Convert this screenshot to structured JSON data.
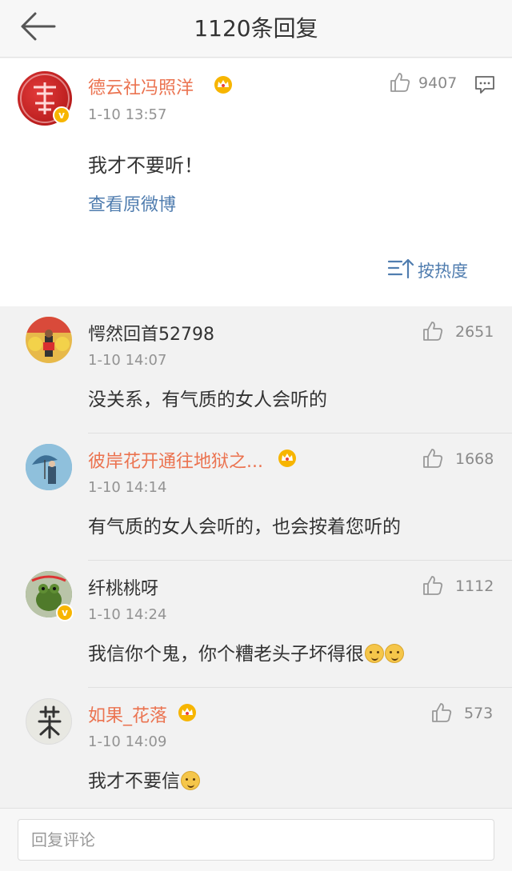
{
  "header": {
    "title": "1120条回复",
    "back_icon": "arrow-left-icon"
  },
  "main_post": {
    "author": "德云社冯照洋",
    "time": "1-10 13:57",
    "likes": "9407",
    "content": "我才不要听！",
    "view_original": "查看原微博",
    "sort_label": "按热度"
  },
  "comments": [
    {
      "author": "愕然回首52798",
      "time": "1-10 14:07",
      "likes": "2651",
      "content": "没关系，有气质的女人会听的"
    },
    {
      "author": "彼岸花开通往地狱之...",
      "time": "1-10 14:14",
      "likes": "1668",
      "content": "有气质的女人会听的，也会按着您听的"
    },
    {
      "author": "纤桃桃呀",
      "time": "1-10 14:24",
      "likes": "1112",
      "content": "我信你个鬼，你个糟老头子坏得很"
    },
    {
      "author": "如果_花落",
      "time": "1-10 14:09",
      "likes": "573",
      "content": "我才不要信"
    }
  ],
  "reply_bar": {
    "placeholder": "回复评论"
  },
  "colors": {
    "vip_name": "#eb7350",
    "link": "#507daf",
    "gray_text": "#939393"
  }
}
